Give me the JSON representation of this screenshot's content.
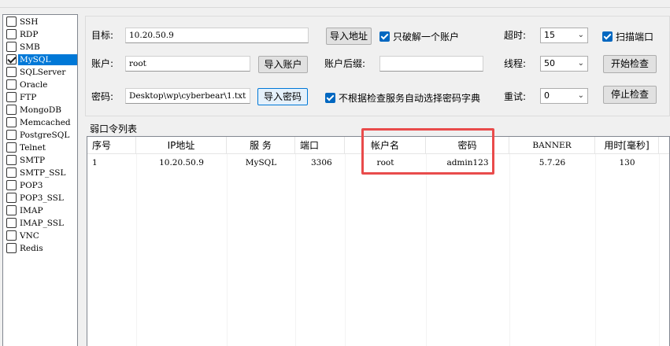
{
  "protocols": [
    {
      "label": "SSH",
      "checked": false
    },
    {
      "label": "RDP",
      "checked": false
    },
    {
      "label": "SMB",
      "checked": false
    },
    {
      "label": "MySQL",
      "checked": true
    },
    {
      "label": "SQLServer",
      "checked": false
    },
    {
      "label": "Oracle",
      "checked": false
    },
    {
      "label": "FTP",
      "checked": false
    },
    {
      "label": "MongoDB",
      "checked": false
    },
    {
      "label": "Memcached",
      "checked": false
    },
    {
      "label": "PostgreSQL",
      "checked": false
    },
    {
      "label": "Telnet",
      "checked": false
    },
    {
      "label": "SMTP",
      "checked": false
    },
    {
      "label": "SMTP_SSL",
      "checked": false
    },
    {
      "label": "POP3",
      "checked": false
    },
    {
      "label": "POP3_SSL",
      "checked": false
    },
    {
      "label": "IMAP",
      "checked": false
    },
    {
      "label": "IMAP_SSL",
      "checked": false
    },
    {
      "label": "VNC",
      "checked": false
    },
    {
      "label": "Redis",
      "checked": false
    }
  ],
  "form": {
    "target_label": "目标:",
    "target_value": "10.20.50.9",
    "import_address": "导入地址",
    "crack_one_label": "只破解一个账户",
    "account_label": "账户:",
    "account_value": "root",
    "import_account": "导入账户",
    "suffix_label": "账户后缀:",
    "suffix_value": "",
    "password_label": "密码:",
    "password_value": "Desktop\\wp\\cyberbear\\1.txt",
    "import_password": "导入密码",
    "auto_dict_label": "不根据检查服务自动选择密码字典",
    "timeout_label": "超时:",
    "timeout_value": "15",
    "threads_label": "线程:",
    "threads_value": "50",
    "retry_label": "重试:",
    "retry_value": "0",
    "scan_port_label": "扫描端口",
    "start_check": "开始检查",
    "stop_check": "停止检查"
  },
  "list": {
    "title": "弱口令列表",
    "columns": [
      "序号",
      "IP地址",
      "服 务",
      "端口",
      "帐户名",
      "密码",
      "BANNER",
      "用时[毫秒]"
    ],
    "rows": [
      [
        "1",
        "10.20.50.9",
        "MySQL",
        "3306",
        "root",
        "admin123",
        "5.7.26",
        "130"
      ]
    ]
  },
  "colors": {
    "highlight": "#e94b4b",
    "selection": "#0078d7",
    "checkbox": "#0067c0"
  }
}
